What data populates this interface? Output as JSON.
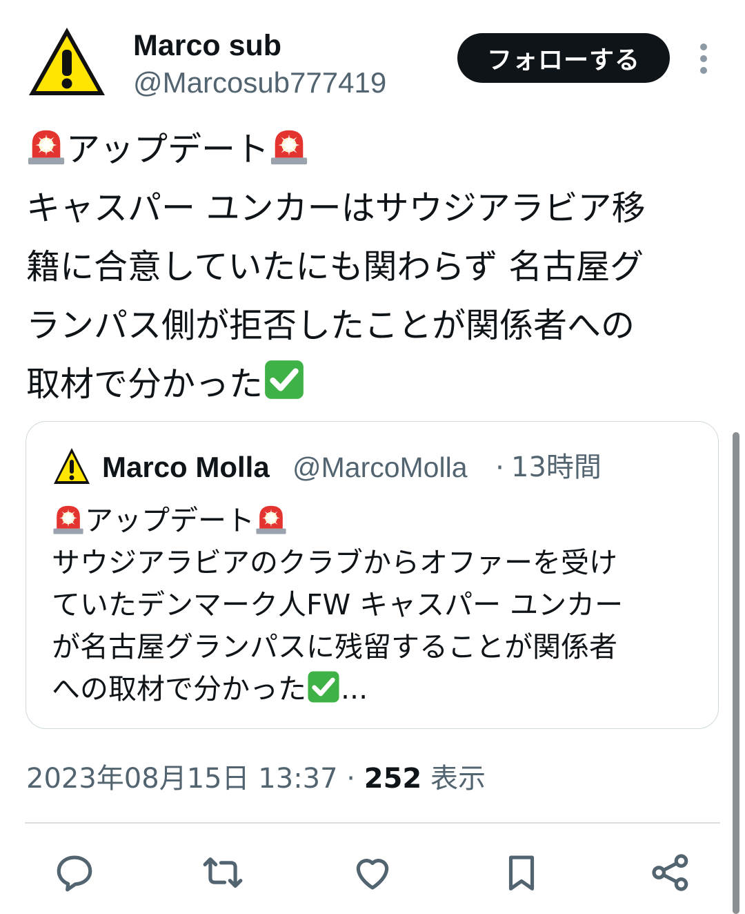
{
  "author": {
    "name": "Marco sub",
    "handle": "@Marcosub777419",
    "avatar_icon": "warning-sign-icon"
  },
  "follow_button": {
    "label": "フォローする"
  },
  "more_icon": "more-vertical-icon",
  "tweet": {
    "lines": [
      "アップデート",
      "キャスパー ユンカーはサウジアラビア移",
      "籍に合意していたにも関わらず 名古屋グ",
      "ランパス側が拒否したことが関係者への",
      "取材で分かった"
    ],
    "emojis": [
      "police-light-icon",
      "check-mark-icon"
    ]
  },
  "quote": {
    "name": "Marco Molla",
    "handle": "@MarcoMolla",
    "separator": "·",
    "time": "13時間",
    "lines": [
      "アップデート",
      "サウジアラビアのクラブからオファーを受け",
      "ていたデンマーク人FW キャスパー ユンカー",
      "が名古屋グランパスに残留することが関係者",
      "への取材で分かった"
    ],
    "ellipsis": "..."
  },
  "meta": {
    "datetime": "2023年08月15日 13:37",
    "separator": " · ",
    "views_count": "252",
    "views_label": " 表示"
  },
  "actions": [
    {
      "name": "reply",
      "icon": "reply-icon"
    },
    {
      "name": "repost",
      "icon": "repost-icon"
    },
    {
      "name": "like",
      "icon": "heart-icon"
    },
    {
      "name": "bookmark",
      "icon": "bookmark-icon"
    },
    {
      "name": "share",
      "icon": "share-icon"
    }
  ],
  "colors": {
    "text_primary": "#0f1419",
    "text_secondary": "#536471",
    "border": "#cfd9de",
    "follow_bg": "#0f1419",
    "icon_gray": "#536471",
    "warning_yellow": "#ffe500",
    "siren_red": "#e3342f",
    "check_green": "#3fb247"
  }
}
